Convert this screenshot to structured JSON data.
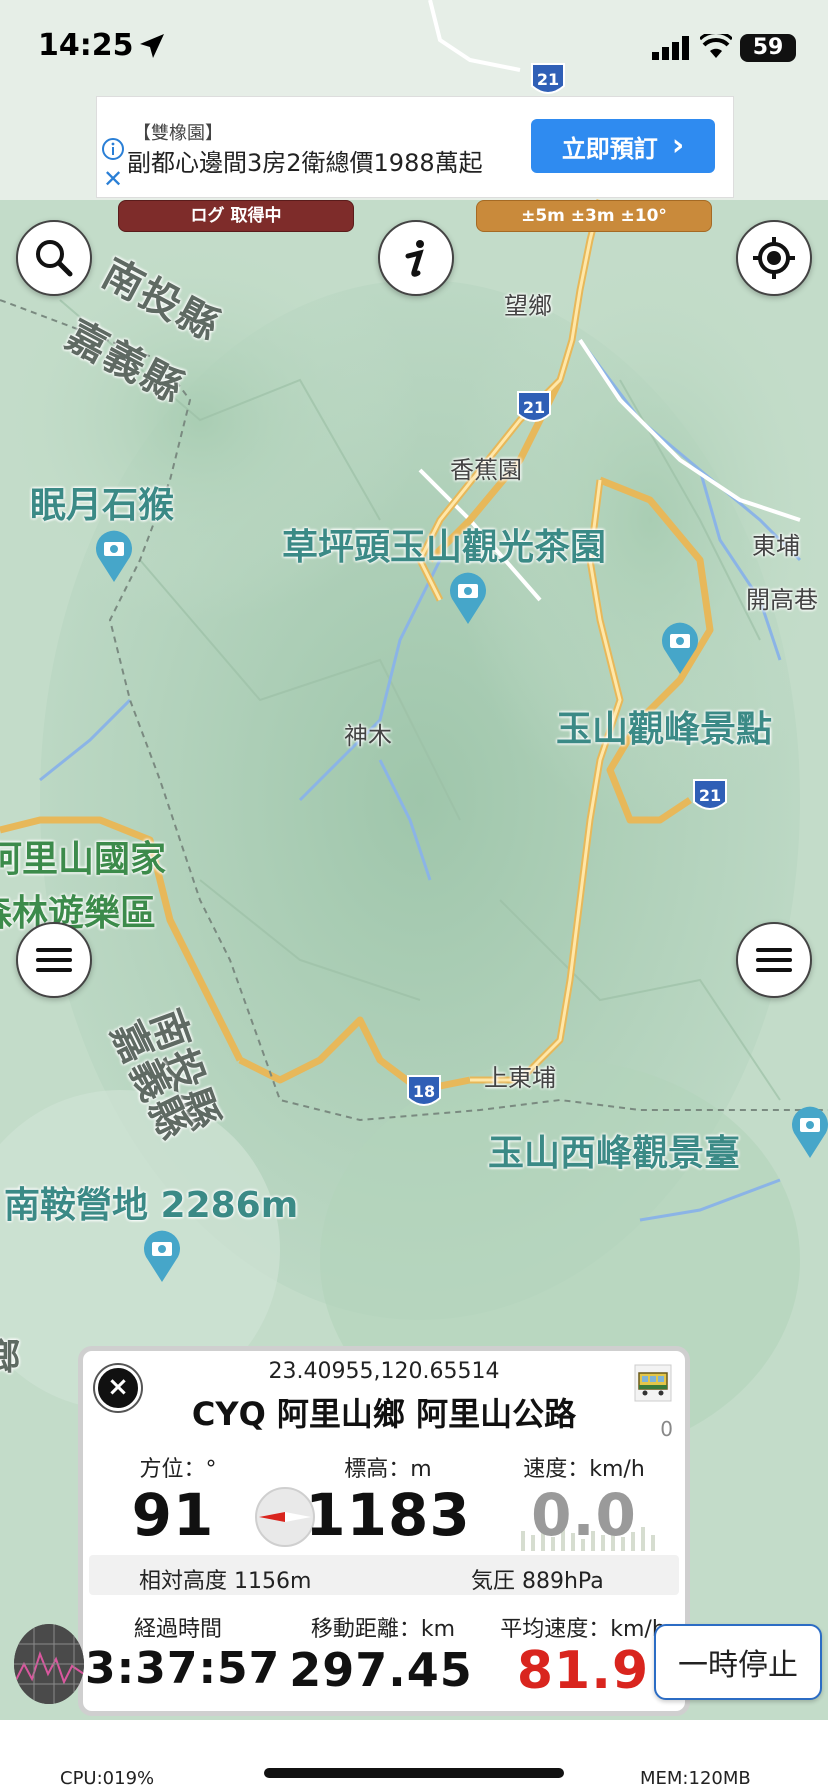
{
  "status_bar": {
    "time": "14:25",
    "battery": "59"
  },
  "ad": {
    "brand": "【雙橡園】",
    "text": "副都心邊間3房2衛總價1988萬起",
    "cta": "立即預訂",
    "cta_arrow": "›",
    "close": "✕"
  },
  "pills": {
    "log": "ログ 取得中",
    "accuracy": "±5m ±3m ±10°"
  },
  "map": {
    "labels": {
      "nantou_county_top": "南投縣",
      "chiayi_county_top": "嘉義縣",
      "nantou_county_mid": "南投縣",
      "chiayi_county_mid": "嘉義縣",
      "poi_left": "眠月石猴",
      "poi_tea": "草坪頭玉山觀光茶園",
      "poi_peak": "玉山觀峰景點",
      "poi_alishan_1": "阿里山國家",
      "poi_alishan_2": "森林遊樂區",
      "poi_west_peak": "玉山西峰觀景臺",
      "poi_camp": "南鞍營地 2286m",
      "place_wangxiang": "望鄉",
      "place_xiangjiao": "香蕉園",
      "place_dongpu": "東埔",
      "place_kaigaoxiang": "開高巷",
      "place_shenmu": "神木",
      "place_shangdongpu": "上東埔",
      "place_edge": "鄉"
    },
    "route_shields": [
      "21",
      "21",
      "21",
      "18"
    ]
  },
  "panel": {
    "coords": "23.40955,120.65514",
    "location": "CYQ 阿里山鄉 阿里山公路",
    "train_count": "0",
    "azimuth_label": "方位：°",
    "azimuth_value": "91",
    "altitude_label": "標高：m",
    "altitude_value": "1183",
    "speed_label": "速度：km/h",
    "speed_value": "0.0",
    "relative_altitude": "相対高度 1156m",
    "pressure": "気圧 889hPa",
    "elapsed_label": "経過時間",
    "elapsed_value": "3:37:57",
    "distance_label": "移動距離：km",
    "distance_value": "297.45",
    "avg_speed_label": "平均速度：km/h",
    "avg_speed_value": "81.9",
    "close": "×"
  },
  "pause_button": "一時停止",
  "footer": {
    "cpu": "CPU:019%",
    "mem": "MEM:120MB"
  },
  "colors": {
    "map_base": "#bcd8c4",
    "road": "#f0c56a",
    "river": "#8bb4e6",
    "accent_blue": "#2f8bf0",
    "log_pill": "#7e2c2a",
    "accuracy_pill": "#c98a3b",
    "avg_speed": "#d9251e"
  }
}
